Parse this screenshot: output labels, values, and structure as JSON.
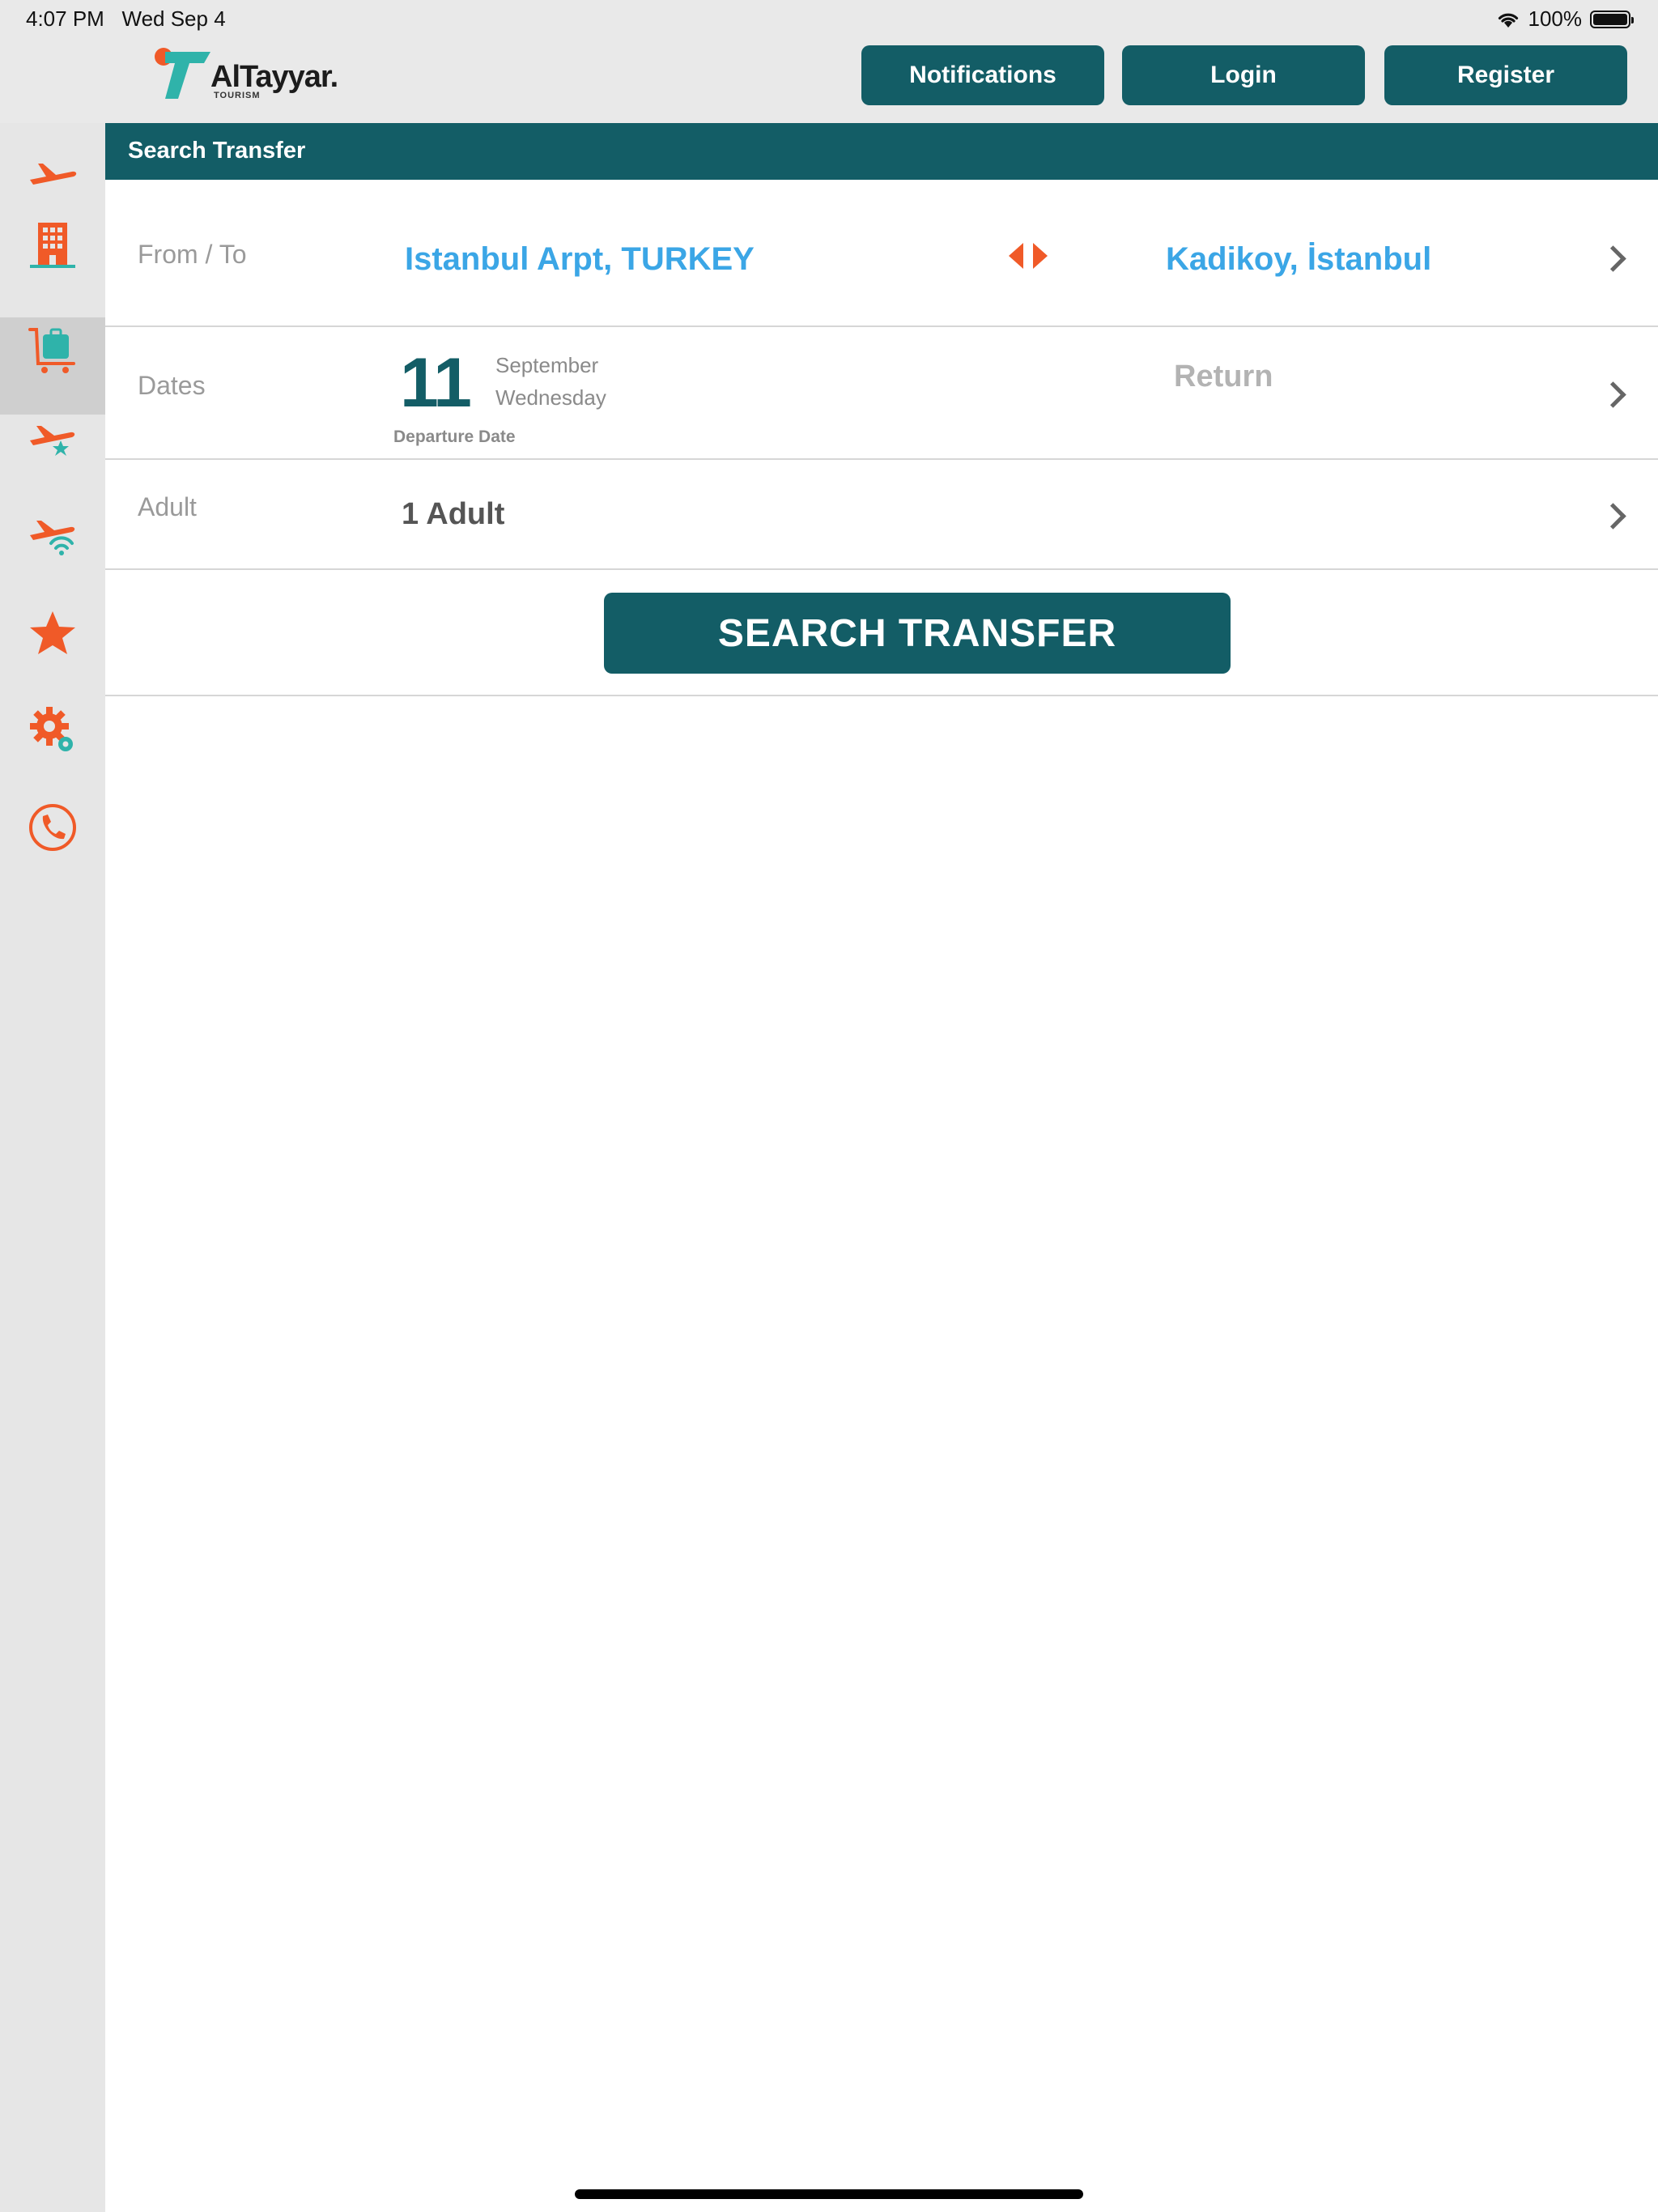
{
  "status_bar": {
    "time": "4:07 PM",
    "date": "Wed Sep 4",
    "battery": "100%",
    "battery_level": 1.0
  },
  "header": {
    "logo_text": "AlTayyar.",
    "logo_subtext": "TOURISM",
    "notifications_label": "Notifications",
    "login_label": "Login",
    "register_label": "Register"
  },
  "sidebar": {
    "items": [
      {
        "name": "flights",
        "icon": "plane-icon",
        "active": false
      },
      {
        "name": "hotels",
        "icon": "hotel-building-icon",
        "active": false
      },
      {
        "name": "transfer",
        "icon": "luggage-cart-icon",
        "active": true
      },
      {
        "name": "featured-flights",
        "icon": "plane-star-icon",
        "active": false
      },
      {
        "name": "flight-status",
        "icon": "plane-wifi-icon",
        "active": false
      },
      {
        "name": "favorites",
        "icon": "star-icon",
        "active": false
      },
      {
        "name": "settings",
        "icon": "gear-icon",
        "active": false
      },
      {
        "name": "contact",
        "icon": "phone-icon",
        "active": false
      }
    ]
  },
  "section": {
    "title": "Search Transfer"
  },
  "form": {
    "from_to_label": "From / To",
    "from_value": "Istanbul Arpt, TURKEY",
    "to_value": "Kadikoy, İstanbul",
    "dates_label": "Dates",
    "departure_day": "11",
    "departure_month": "September",
    "departure_weekday": "Wednesday",
    "departure_caption": "Departure Date",
    "return_label": "Return",
    "adult_label": "Adult",
    "adult_value": "1 Adult",
    "search_button": "SEARCH TRANSFER"
  },
  "colors": {
    "primary": "#135d66",
    "accent": "#f05a28",
    "link": "#3ba6e6",
    "teal": "#2fb3aa"
  }
}
